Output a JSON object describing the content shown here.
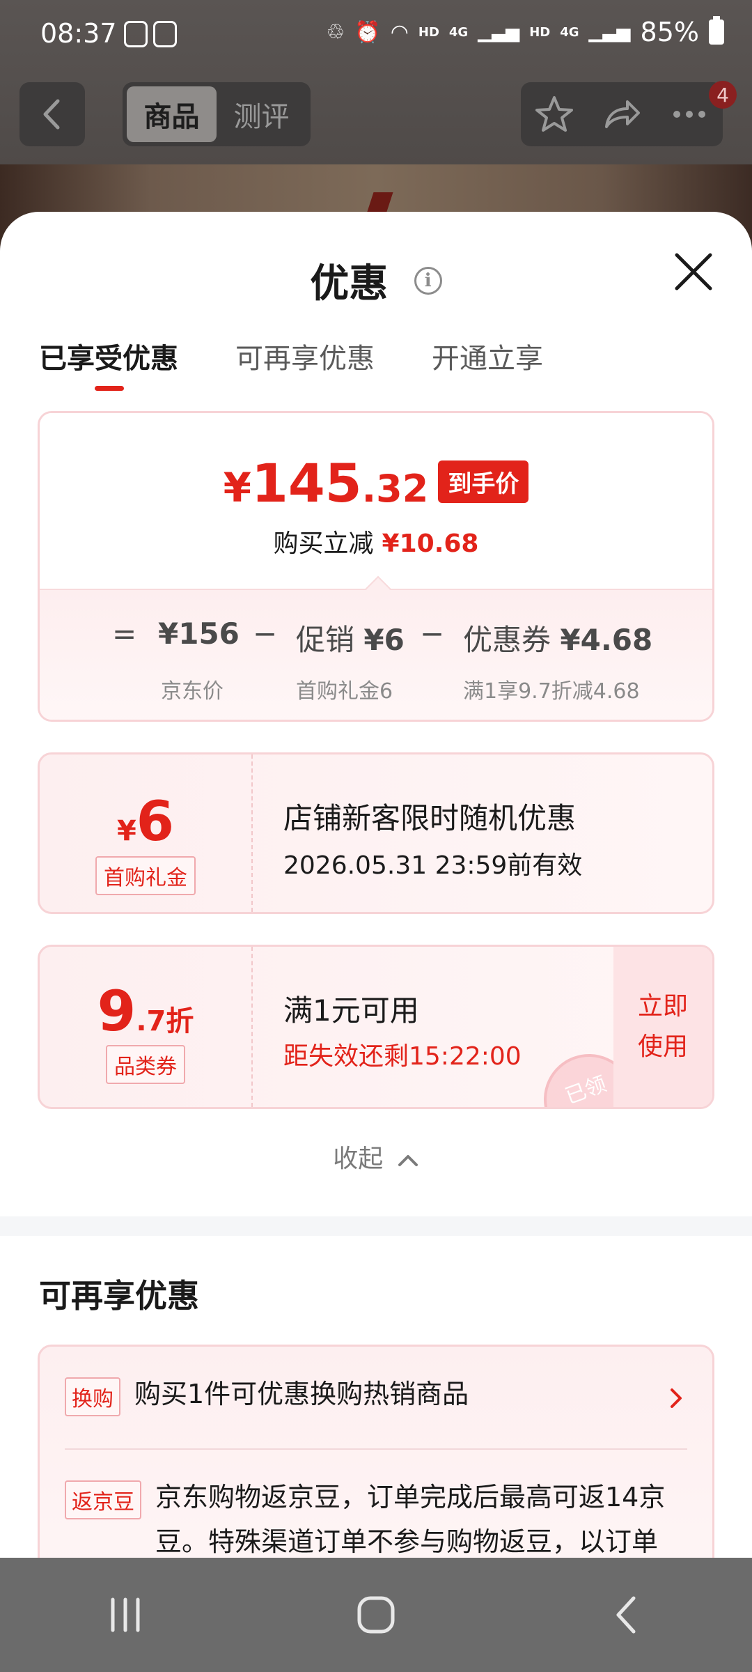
{
  "status_bar": {
    "time": "08:37",
    "signal_labels": [
      "HD",
      "4G",
      "HD",
      "4G"
    ],
    "battery": "85%"
  },
  "top_nav": {
    "segments": [
      "商品",
      "测评"
    ],
    "active_segment": "商品",
    "notification_count": "4"
  },
  "sheet": {
    "title": "优惠",
    "tabs": [
      "已享受优惠",
      "可再享优惠",
      "开通立享"
    ],
    "active_tab": "已享受优惠",
    "summary": {
      "currency": "¥",
      "price_int": "145",
      "price_dec": ".32",
      "price_tag": "到手价",
      "reduce_label": "购买立减",
      "reduce_amount": "¥10.68",
      "equals": "=",
      "minus": "−",
      "items": [
        {
          "label": "",
          "value": "¥156",
          "sub": "京东价"
        },
        {
          "label": "促销",
          "value": "¥6",
          "sub": "首购礼金6"
        },
        {
          "label": "优惠券",
          "value": "¥4.68",
          "sub": "满1享9.7折减4.68"
        }
      ]
    },
    "coupons": [
      {
        "amount_prefix": "¥",
        "amount_main": "6",
        "amount_suffix": "",
        "tag": "首购礼金",
        "title": "店铺新客限时随机优惠",
        "subtitle": "2026.05.31 23:59前有效"
      },
      {
        "amount_prefix": "",
        "amount_main": "9",
        "amount_suffix": ".7折",
        "tag": "品类券",
        "title": "满1元可用",
        "subtitle": "距失效还剩15:22:00",
        "button": [
          "立即",
          "使用"
        ],
        "stamp": "已领"
      }
    ],
    "collapse_label": "收起",
    "more_section": {
      "title": "可再享优惠",
      "rows": [
        {
          "tag": "换购",
          "text": "购买1件可优惠换购热销商品"
        },
        {
          "tag": "返京豆",
          "text": "京东购物返京豆，订单完成后最高可返14京豆。特殊渠道订单不参与购物返豆，以订单"
        }
      ]
    }
  },
  "colors": {
    "accent": "#e2231a",
    "card_border": "#f7d3d6",
    "card_bg": "#fdeff0"
  }
}
